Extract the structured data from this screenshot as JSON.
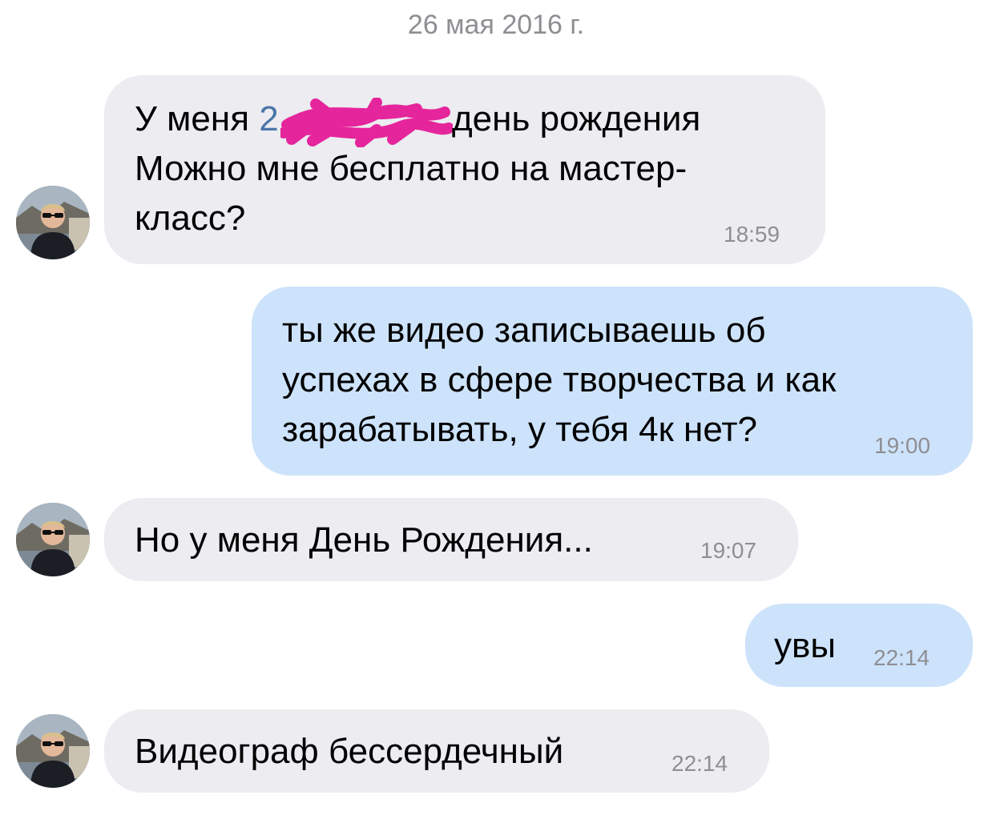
{
  "date_header": "26 мая 2016 г.",
  "colors": {
    "incoming_bubble": "#ececf1",
    "outgoing_bubble": "#cde3fb",
    "time_text": "#8e8e93",
    "link_text": "#4a76a8",
    "redaction": "#e5259b"
  },
  "messages": [
    {
      "direction": "incoming",
      "lines": [
        "У меня ",
        "день рождения",
        "Можно мне бесплатно на мастер-",
        "класс?"
      ],
      "link_prefix": "2",
      "time": "18:59"
    },
    {
      "direction": "outgoing",
      "lines": [
        "ты же видео записываешь об",
        "успехах в сфере творчества и как",
        "зарабатывать, у тебя 4к нет?"
      ],
      "time": "19:00"
    },
    {
      "direction": "incoming",
      "lines": [
        "Но у меня День Рождения..."
      ],
      "time": "19:07"
    },
    {
      "direction": "outgoing",
      "lines": [
        "увы"
      ],
      "time": "22:14"
    },
    {
      "direction": "incoming",
      "lines": [
        "Видеограф бессердечный"
      ],
      "time": "22:14"
    }
  ]
}
